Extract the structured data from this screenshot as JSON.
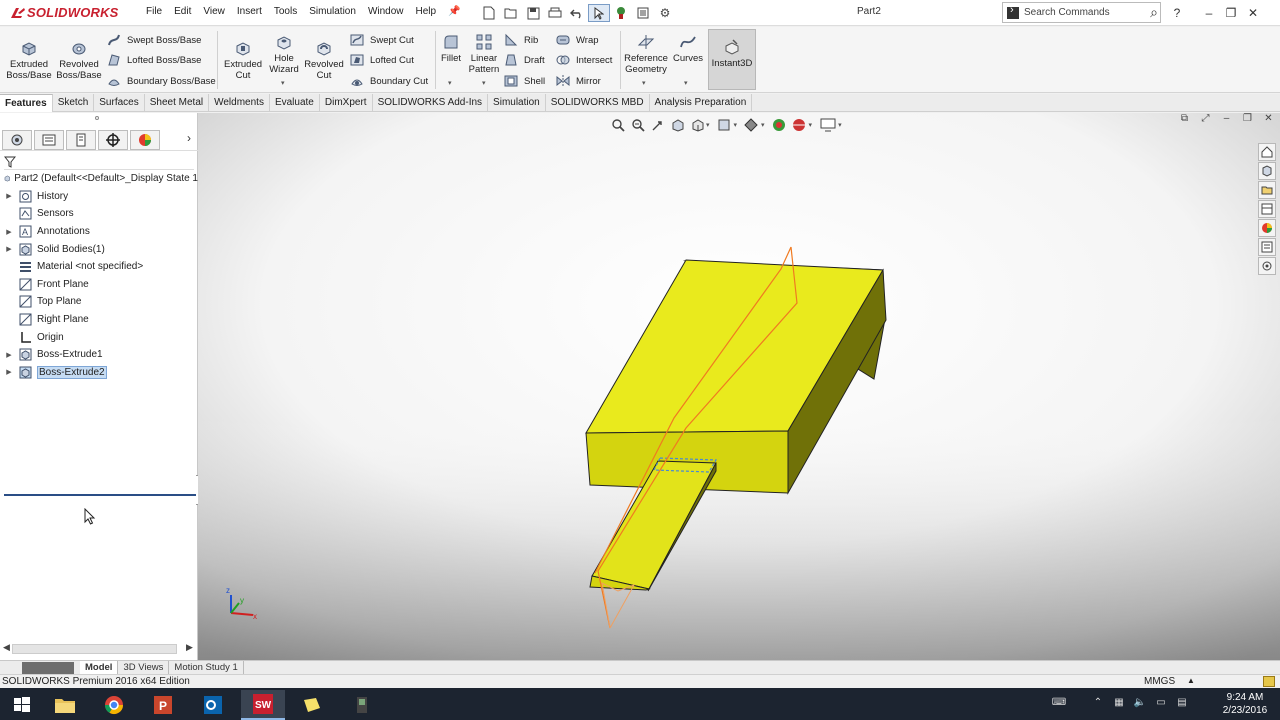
{
  "app": {
    "logo_text": "SOLIDWORKS",
    "doc_title": "Part2"
  },
  "menu": [
    "File",
    "Edit",
    "View",
    "Insert",
    "Tools",
    "Simulation",
    "Window",
    "Help"
  ],
  "search": {
    "placeholder": "Search Commands"
  },
  "commands": {
    "extruded_boss": "Extruded Boss/Base",
    "revolved_boss": "Revolved Boss/Base",
    "swept_boss": "Swept Boss/Base",
    "lofted_boss": "Lofted Boss/Base",
    "boundary_boss": "Boundary Boss/Base",
    "extruded_cut": "Extruded Cut",
    "hole_wizard": "Hole Wizard",
    "revolved_cut": "Revolved Cut",
    "swept_cut": "Swept Cut",
    "lofted_cut": "Lofted Cut",
    "boundary_cut": "Boundary Cut",
    "fillet": "Fillet",
    "linear_pattern": "Linear Pattern",
    "rib": "Rib",
    "draft": "Draft",
    "shell": "Shell",
    "wrap": "Wrap",
    "intersect": "Intersect",
    "mirror": "Mirror",
    "reference_geometry": "Reference Geometry",
    "curves": "Curves",
    "instant3d": "Instant3D"
  },
  "tabs": [
    "Features",
    "Sketch",
    "Surfaces",
    "Sheet Metal",
    "Weldments",
    "Evaluate",
    "DimXpert",
    "SOLIDWORKS Add-Ins",
    "Simulation",
    "SOLIDWORKS MBD",
    "Analysis Preparation"
  ],
  "tree": {
    "root": "Part2  (Default<<Default>_Display State 1",
    "items": [
      {
        "label": "History",
        "expandable": true
      },
      {
        "label": "Sensors",
        "expandable": false
      },
      {
        "label": "Annotations",
        "expandable": true
      },
      {
        "label": "Solid Bodies(1)",
        "expandable": true
      },
      {
        "label": "Material <not specified>",
        "expandable": false
      },
      {
        "label": "Front Plane",
        "expandable": false
      },
      {
        "label": "Top Plane",
        "expandable": false
      },
      {
        "label": "Right Plane",
        "expandable": false
      },
      {
        "label": "Origin",
        "expandable": false
      },
      {
        "label": "Boss-Extrude1",
        "expandable": true
      },
      {
        "label": "Boss-Extrude2",
        "expandable": true
      }
    ]
  },
  "bottom_tabs": [
    "Model",
    "3D Views",
    "Motion Study 1"
  ],
  "status": {
    "text": "SOLIDWORKS Premium 2016 x64 Edition",
    "units": "MMGS"
  },
  "clock": {
    "time": "9:24 AM",
    "date": "2/23/2016"
  },
  "colors": {
    "part_face_top": "#e9ea1d",
    "part_face_front": "#d4d40f",
    "part_face_side": "#6e6f08",
    "edge_orange": "#f07a20",
    "brand_red": "#c8202f"
  },
  "triad_labels": [
    "z",
    "y",
    "x"
  ]
}
